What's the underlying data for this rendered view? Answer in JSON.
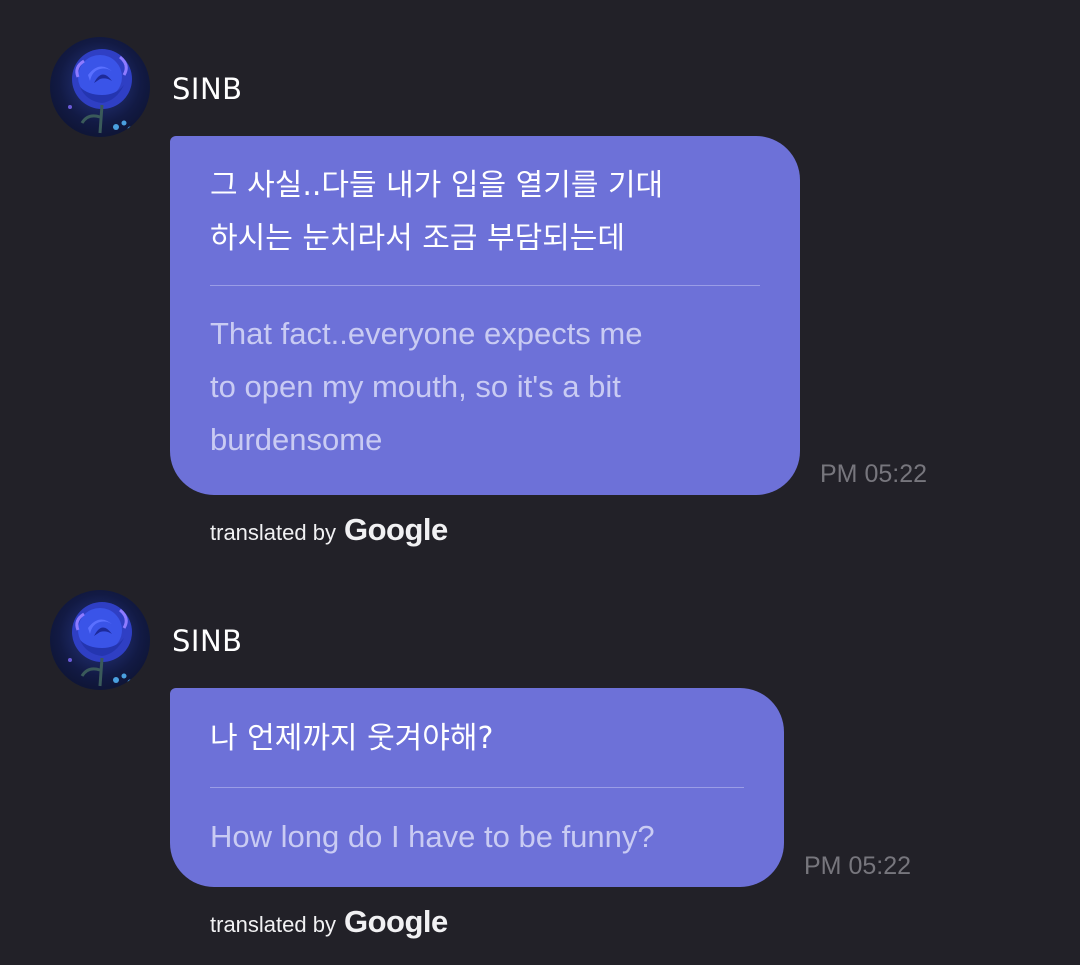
{
  "messages": [
    {
      "sender": "SINB",
      "original_lines": [
        "그 사실..다들 내가 입을 열기를 기대",
        "하시는 눈치라서 조금 부담되는데"
      ],
      "translated_lines": [
        "That fact..everyone expects me",
        "to open my mouth, so it's a bit",
        "burdensome"
      ],
      "time": "PM 05:22",
      "attribution_prefix": "translated by",
      "attribution_brand": "Google"
    },
    {
      "sender": "SINB",
      "original_lines": [
        "나 언제까지 웃겨야해?"
      ],
      "translated_lines": [
        "How long do I have to be funny?"
      ],
      "time": "PM 05:22",
      "attribution_prefix": "translated by",
      "attribution_brand": "Google"
    }
  ],
  "colors": {
    "background": "#222128",
    "bubble": "#6d71d8",
    "translated_text": "#c9cbf3",
    "timestamp": "#77767d"
  },
  "icons": {
    "avatar": "blue-rose-avatar-icon"
  }
}
